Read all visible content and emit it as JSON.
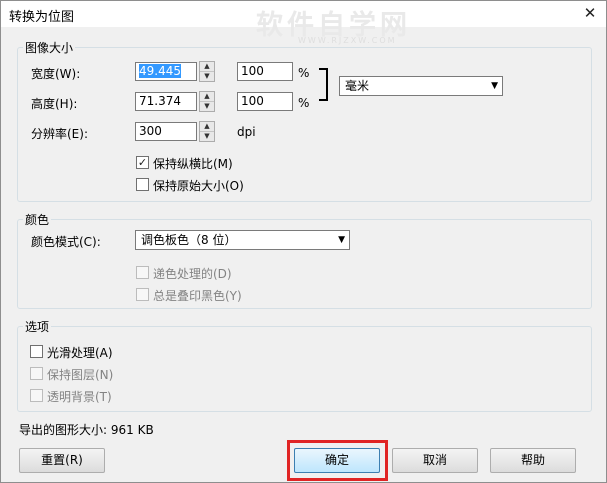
{
  "window": {
    "title": "转换为位图",
    "close_glyph": "✕"
  },
  "watermark": {
    "main": "软件自学网",
    "sub": "WWW.RJZXW.COM"
  },
  "image_size": {
    "group_title": "图像大小",
    "width_label": "宽度(W):",
    "width_value": "49.445",
    "width_percent": "100",
    "height_label": "高度(H):",
    "height_value": "71.374",
    "height_percent": "100",
    "percent_sign": "%",
    "unit": "毫米",
    "resolution_label": "分辨率(E):",
    "resolution_value": "300",
    "resolution_unit": "dpi",
    "keep_aspect_label": "保持纵横比(M)",
    "keep_aspect_checked": true,
    "keep_original_label": "保持原始大小(O)",
    "keep_original_checked": false
  },
  "color": {
    "group_title": "颜色",
    "mode_label": "颜色模式(C):",
    "mode_value": "调色板色（8 位）",
    "dither_label": "递色处理的(D)",
    "overprint_label": "总是叠印黑色(Y)"
  },
  "options": {
    "group_title": "选项",
    "antialias_label": "光滑处理(A)",
    "antialias_checked": false,
    "keep_layers_label": "保持图层(N)",
    "transparent_label": "透明背景(T)"
  },
  "export_size": "导出的图形大小: 961 KB",
  "buttons": {
    "reset": "重置(R)",
    "ok": "确定",
    "cancel": "取消",
    "help": "帮助"
  },
  "glyphs": {
    "check": "✓",
    "spin_up": "▲",
    "spin_down": "▼",
    "combo_arrow": "▼"
  },
  "colors": {
    "highlight": "#e02424",
    "selection": "#3399ff"
  }
}
